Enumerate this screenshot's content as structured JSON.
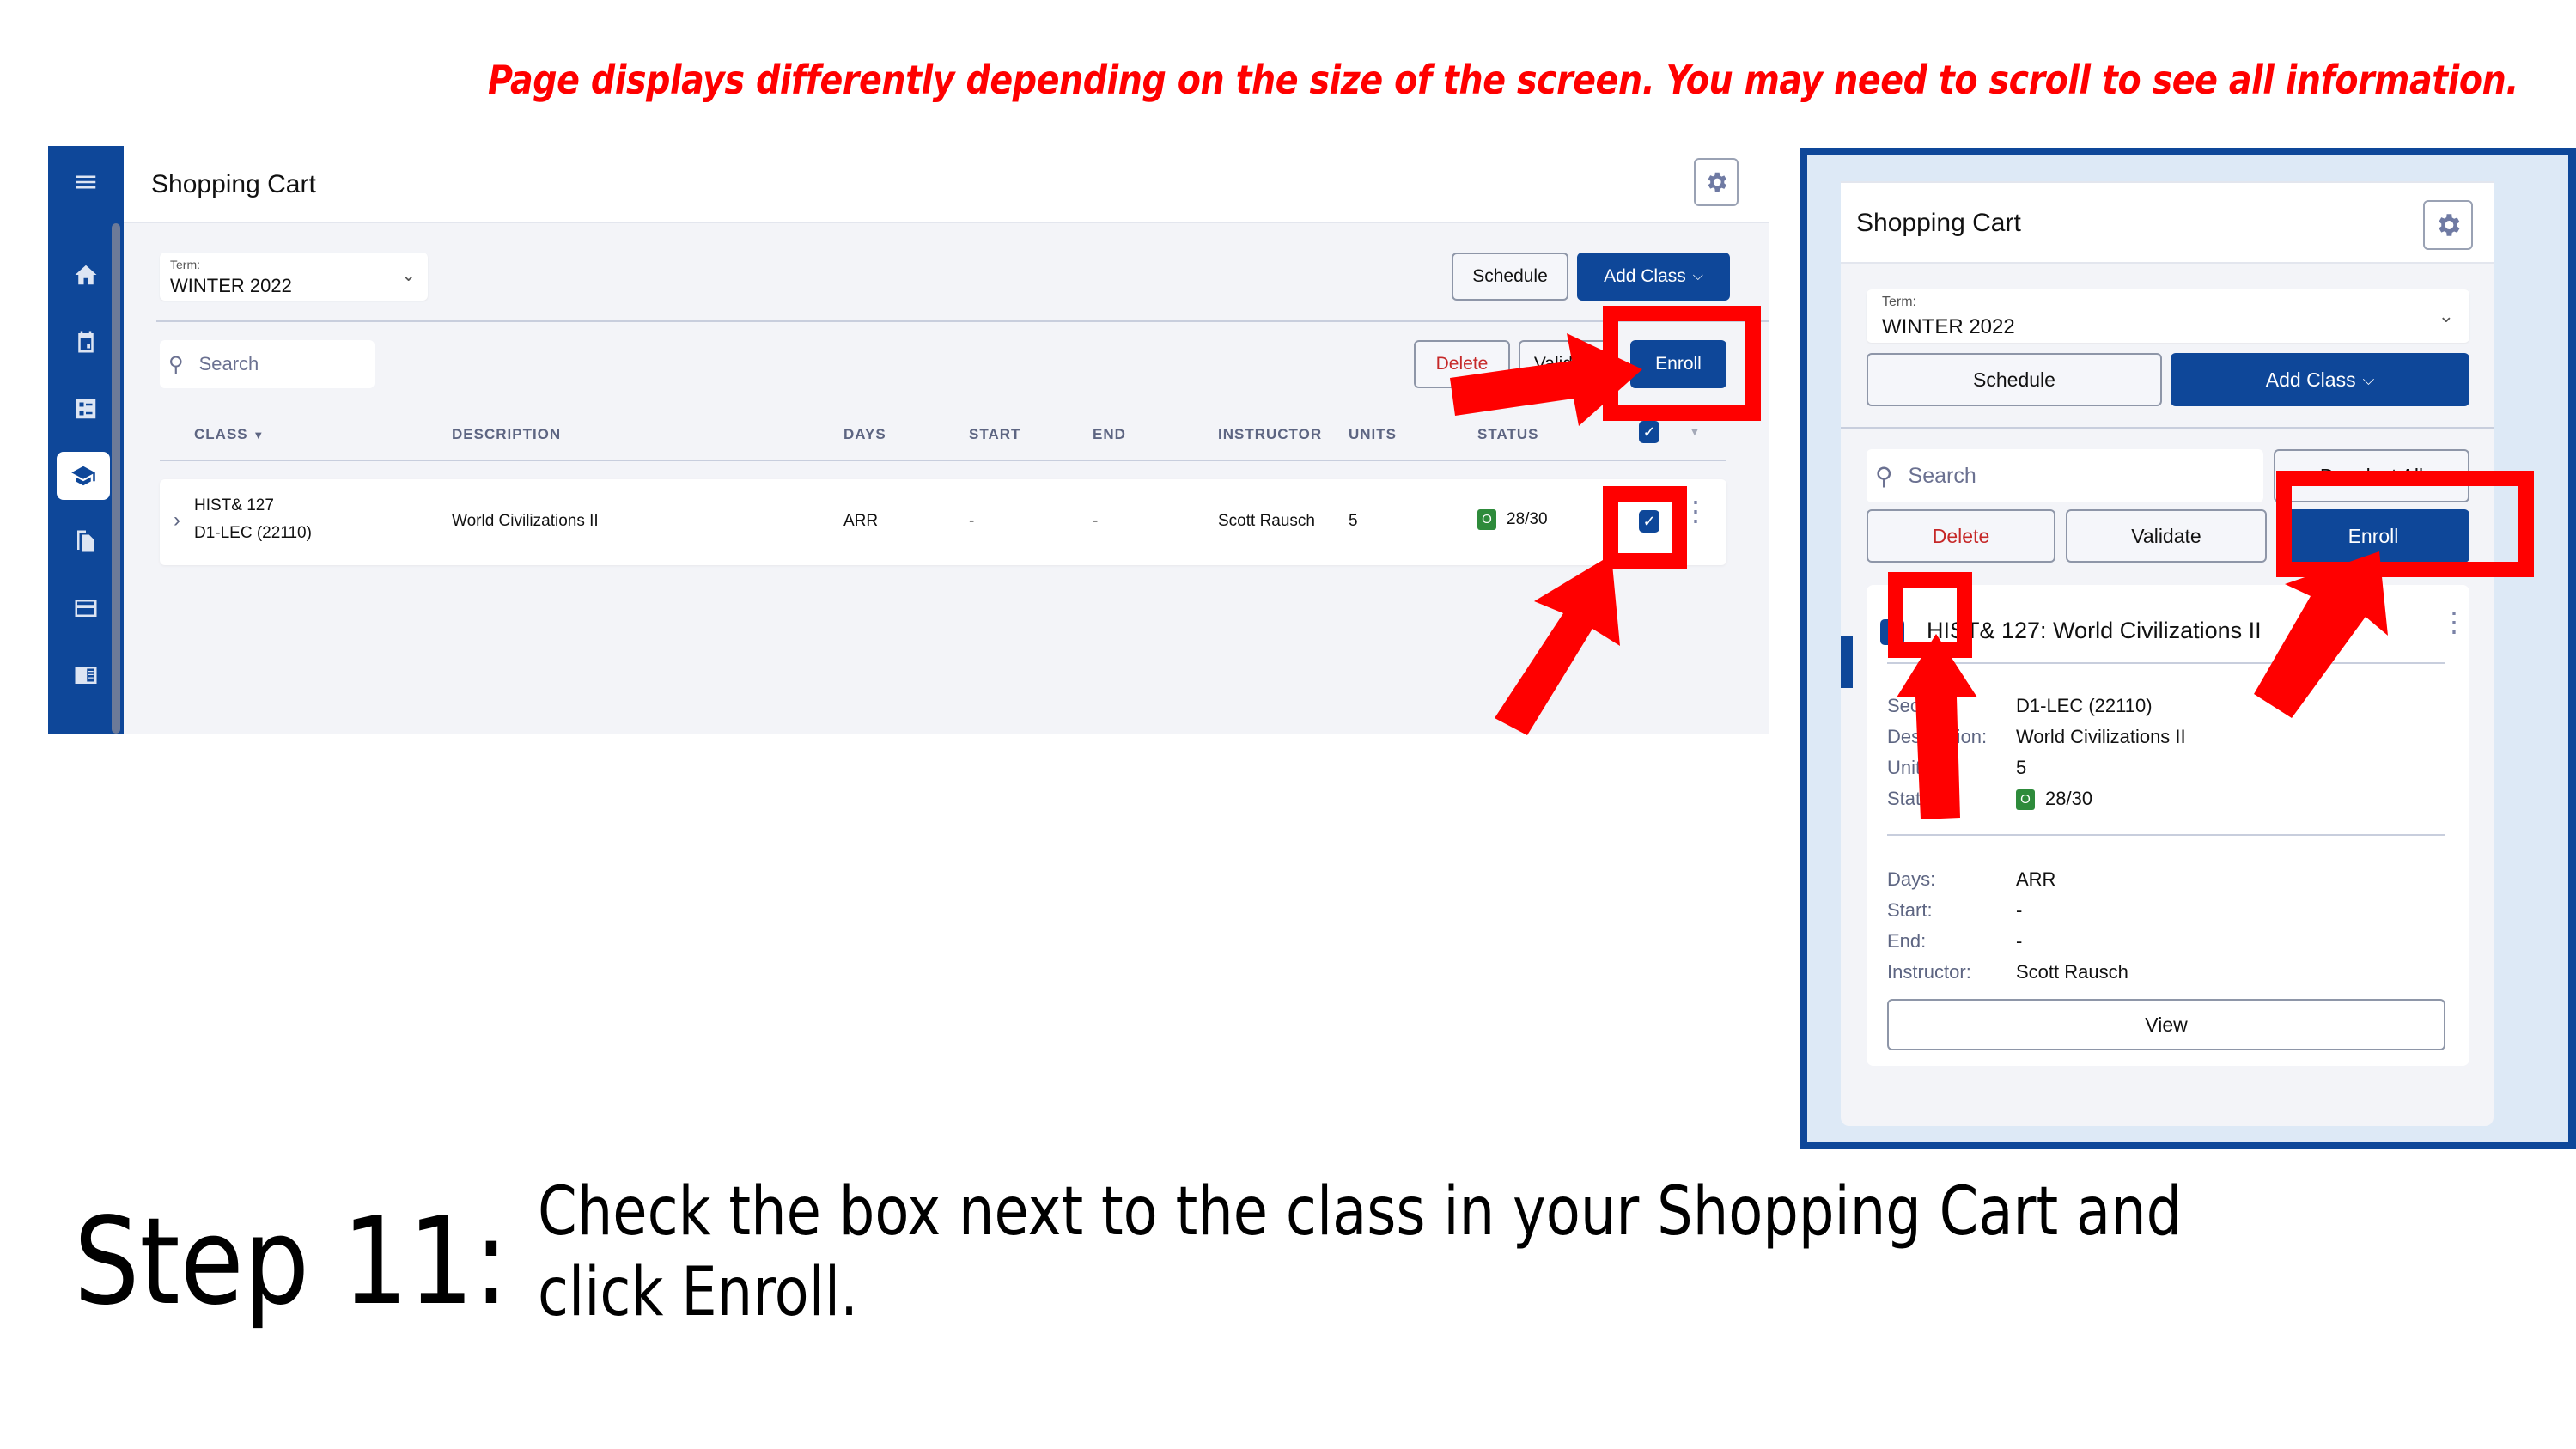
{
  "notice": "Page displays differently depending on the size of the screen. You may need to scroll to see all information.",
  "desktop": {
    "sidebar_icons": [
      "menu-icon",
      "home-icon",
      "calendar-icon",
      "checklist-icon",
      "graduation-cap-icon",
      "documents-icon",
      "credit-card-icon",
      "catalog-icon"
    ],
    "page_title": "Shopping Cart",
    "term_label": "Term:",
    "term_value": "WINTER 2022",
    "schedule_label": "Schedule",
    "add_class_label": "Add Class",
    "search_placeholder": "Search",
    "delete_label": "Delete",
    "validate_label": "Validate",
    "enroll_label": "Enroll",
    "columns": [
      "CLASS",
      "DESCRIPTION",
      "DAYS",
      "START",
      "END",
      "INSTRUCTOR",
      "UNITS",
      "STATUS"
    ],
    "row": {
      "class_line1": "HIST& 127",
      "class_line2": "D1-LEC (22110)",
      "description": "World Civilizations II",
      "days": "ARR",
      "start": "-",
      "end": "-",
      "instructor": "Scott Rausch",
      "units": "5",
      "status_badge": "O",
      "status_seats": "28/30",
      "selected": true
    }
  },
  "mobile": {
    "page_title": "Shopping Cart",
    "term_label": "Term:",
    "term_value": "WINTER 2022",
    "schedule_label": "Schedule",
    "add_class_label": "Add Class",
    "search_placeholder": "Search",
    "deselect_all_label": "Deselect All",
    "delete_label": "Delete",
    "validate_label": "Validate",
    "enroll_label": "Enroll",
    "card": {
      "title": "HIST& 127: World Civilizations II",
      "selected": true,
      "fields_top": [
        {
          "label": "Section:",
          "value": "D1-LEC (22110)"
        },
        {
          "label": "Description:",
          "value": "World Civilizations II"
        },
        {
          "label": "Units:",
          "value": "5"
        },
        {
          "label": "Status:",
          "value": "28/30",
          "badge": "O"
        }
      ],
      "fields_bottom": [
        {
          "label": "Days:",
          "value": "ARR"
        },
        {
          "label": "Start:",
          "value": "-"
        },
        {
          "label": "End:",
          "value": "-"
        },
        {
          "label": "Instructor:",
          "value": "Scott Rausch"
        }
      ],
      "view_label": "View"
    }
  },
  "step": {
    "number": "Step 11:",
    "instruction": "Check the box next to the class in your Shopping Cart and click Enroll."
  },
  "colors": {
    "brand_blue": "#0e4799",
    "annotation_red": "#ff0000",
    "status_open_green": "#2e8b3b",
    "delete_red": "#c62828"
  }
}
